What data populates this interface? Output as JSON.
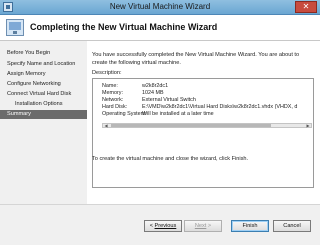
{
  "window": {
    "title": "New Virtual Machine Wizard",
    "close_glyph": "✕"
  },
  "header": {
    "title": "Completing the New Virtual Machine Wizard",
    "icon": "virtual-machine-icon"
  },
  "sidebar": {
    "items": [
      {
        "label": "Before You Begin",
        "sub": false,
        "active": false
      },
      {
        "label": "Specify Name and Location",
        "sub": false,
        "active": false
      },
      {
        "label": "Assign Memory",
        "sub": false,
        "active": false
      },
      {
        "label": "Configure Networking",
        "sub": false,
        "active": false
      },
      {
        "label": "Connect Virtual Hard Disk",
        "sub": false,
        "active": false
      },
      {
        "label": "Installation Options",
        "sub": true,
        "active": false
      },
      {
        "label": "Summary",
        "sub": false,
        "active": true
      }
    ]
  },
  "content": {
    "intro": "You have successfully completed the New Virtual Machine Wizard. You are about to create the following virtual machine.",
    "description_label": "Description:",
    "description_rows": [
      {
        "key": "Name:",
        "value": "w2k8r2dc1"
      },
      {
        "key": "Memory:",
        "value": "1024 MB"
      },
      {
        "key": "Network:",
        "value": "External Virtual Switch"
      },
      {
        "key": "Hard Disk:",
        "value": "E:\\VMD\\w2k8r2dc1\\Virtual Hard Disks\\w2k8r2dc1.vhdx (VHDX, d"
      },
      {
        "key": "Operating System:",
        "value": "Will be installed at a later time"
      }
    ],
    "finish_text": "To create the virtual machine and close the wizard, click Finish."
  },
  "footer": {
    "previous": {
      "arrow": "<",
      "label": "Previous"
    },
    "next": {
      "label": "Next",
      "arrow": ">"
    },
    "finish": "Finish",
    "cancel": "Cancel"
  },
  "colors": {
    "active_nav": "#6b6b6b",
    "titlebar": "#8fbfe0",
    "close": "#c74b3e"
  }
}
